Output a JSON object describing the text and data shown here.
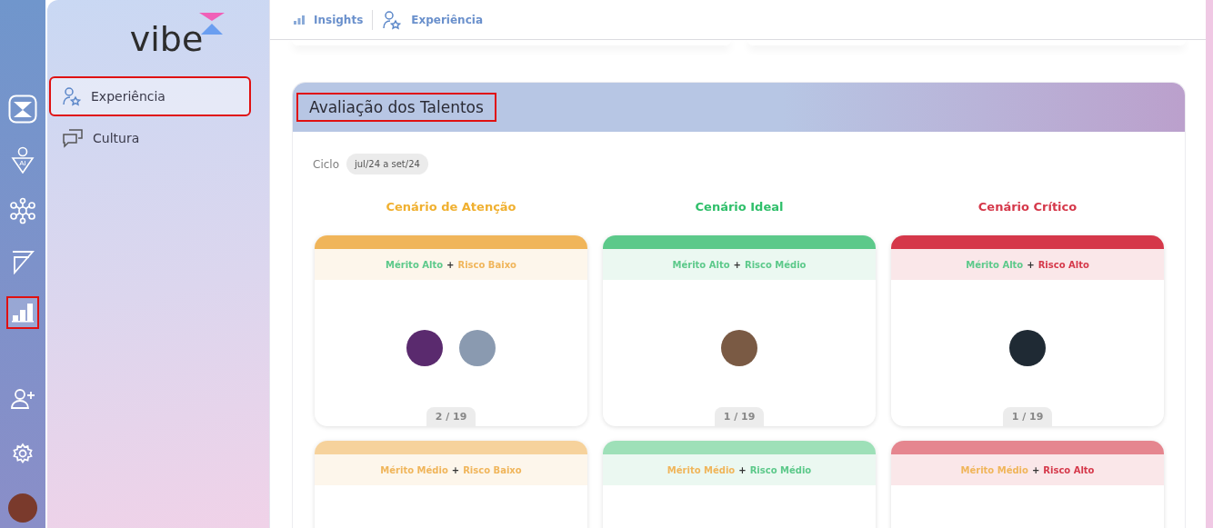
{
  "rail": {
    "items": [
      {
        "kind": "logo",
        "selected": false,
        "highlighted": false
      },
      {
        "kind": "ai-user",
        "badge": "AI",
        "selected": false,
        "highlighted": false
      },
      {
        "kind": "network",
        "selected": false,
        "highlighted": false
      },
      {
        "kind": "panel",
        "selected": false,
        "highlighted": false
      },
      {
        "kind": "chart",
        "selected": true,
        "highlighted": true
      }
    ],
    "bottom": [
      {
        "kind": "add-user"
      },
      {
        "kind": "settings"
      },
      {
        "kind": "avatar"
      }
    ]
  },
  "sidebar": {
    "logo": "vibe",
    "items": [
      {
        "label": "Experiência",
        "selected": true,
        "highlighted": true
      },
      {
        "label": "Cultura",
        "selected": false,
        "highlighted": false
      }
    ]
  },
  "breadcrumbs": [
    {
      "label": "Insights"
    },
    {
      "label": "Experiência"
    }
  ],
  "section": {
    "title": "Avaliação dos Talentos",
    "highlighted": true,
    "cycle_label": "Ciclo",
    "cycle": "jul/24 a set/24",
    "columns": [
      {
        "title": "Cenário de Atenção",
        "color": "#f0b030"
      },
      {
        "title": "Cenário Ideal",
        "color": "#2fbf6a"
      },
      {
        "title": "Cenário Crítico",
        "color": "#d5384a"
      }
    ],
    "cards": [
      {
        "color": "#f0b55a",
        "merit": {
          "text": "Mérito Alto",
          "color": "#5cc98a"
        },
        "joiner": "+",
        "risk": {
          "text": "Risco Baixo",
          "color": "#f0b55a"
        },
        "avatars": [
          {
            "color": "#5a2a6e"
          },
          {
            "color": "#8a9ab0"
          }
        ],
        "count": "2 / 19"
      },
      {
        "color": "#5cc98a",
        "merit": {
          "text": "Mérito Alto",
          "color": "#5cc98a"
        },
        "joiner": "+",
        "risk": {
          "text": "Risco Médio",
          "color": "#5cc98a"
        },
        "avatars": [
          {
            "color": "#7a5a44"
          }
        ],
        "count": "1 / 19"
      },
      {
        "color": "#d5384a",
        "merit": {
          "text": "Mérito Alto",
          "color": "#5cc98a"
        },
        "joiner": "+",
        "risk": {
          "text": "Risco Alto",
          "color": "#d5384a"
        },
        "avatars": [
          {
            "color": "#1f2a34"
          }
        ],
        "count": "1 / 19"
      },
      {
        "color": "#f6d29c",
        "merit": {
          "text": "Mérito Médio",
          "color": "#f0b55a"
        },
        "joiner": "+",
        "risk": {
          "text": "Risco Baixo",
          "color": "#f0b55a"
        }
      },
      {
        "color": "#9ee0b8",
        "merit": {
          "text": "Mérito Médio",
          "color": "#f0b55a"
        },
        "joiner": "+",
        "risk": {
          "text": "Risco Médio",
          "color": "#5cc98a"
        }
      },
      {
        "color": "#e5868f",
        "merit": {
          "text": "Mérito Médio",
          "color": "#f0b55a"
        },
        "joiner": "+",
        "risk": {
          "text": "Risco Alto",
          "color": "#d5384a"
        }
      }
    ]
  }
}
